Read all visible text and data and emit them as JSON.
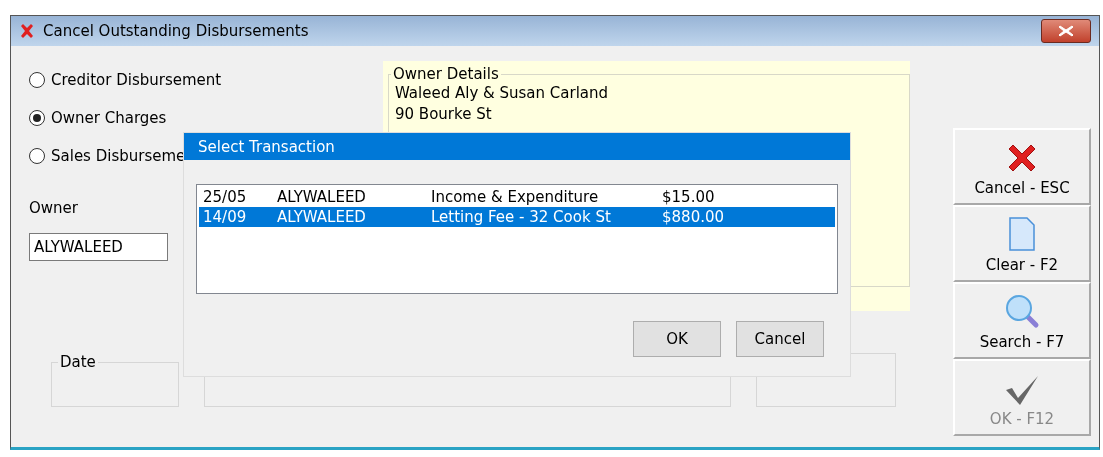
{
  "window": {
    "title": "Cancel Outstanding Disbursements"
  },
  "disbursement_types": [
    {
      "label": "Creditor Disbursement",
      "selected": false
    },
    {
      "label": "Owner Charges",
      "selected": true
    },
    {
      "label": "Sales Disburseme",
      "selected": false
    }
  ],
  "owner": {
    "label": "Owner",
    "value": "ALYWALEED"
  },
  "owner_details": {
    "title": "Owner Details",
    "lines": [
      "Waleed Aly & Susan Carland",
      "90 Bourke St"
    ]
  },
  "date": {
    "title": "Date"
  },
  "side_buttons": [
    {
      "label": "Cancel - ESC",
      "kind": "cancel",
      "disabled": false
    },
    {
      "label": "Clear - F2",
      "kind": "clear",
      "disabled": false
    },
    {
      "label": "Search - F7",
      "kind": "search",
      "disabled": false
    },
    {
      "label": "OK - F12",
      "kind": "ok",
      "disabled": true
    }
  ],
  "dialog": {
    "title": "Select Transaction",
    "rows": [
      {
        "cells": [
          "25/05",
          "ALYWALEED",
          "Income & Expenditure",
          "$15.00"
        ],
        "selected": false
      },
      {
        "cells": [
          "14/09",
          "ALYWALEED",
          "Letting Fee - 32 Cook St",
          "$880.00"
        ],
        "selected": true
      }
    ],
    "buttons": [
      "OK",
      "Cancel"
    ]
  }
}
